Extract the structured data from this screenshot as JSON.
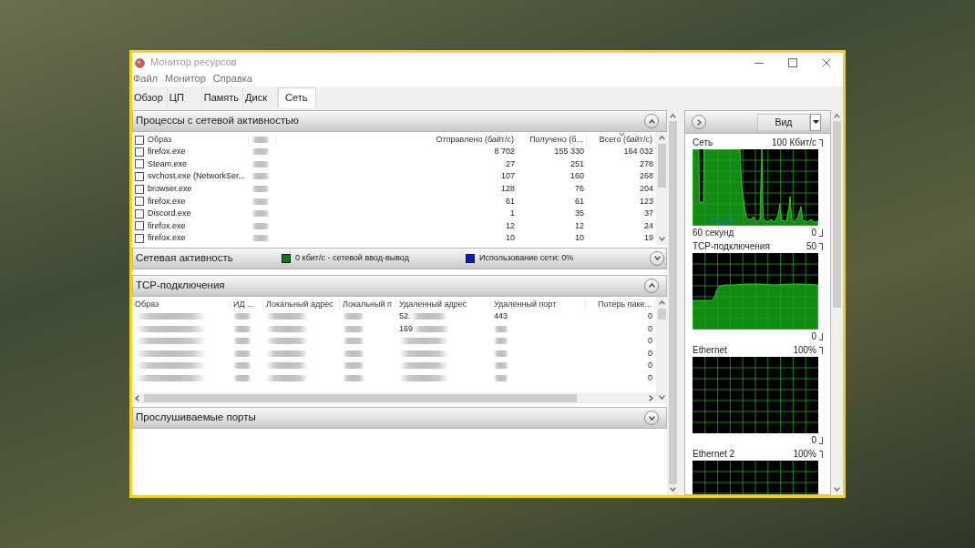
{
  "window": {
    "title": "Монитор ресурсов"
  },
  "menu": [
    "Файл",
    "Монитор",
    "Справка"
  ],
  "tabs": [
    {
      "label": "Обзор",
      "selected": false
    },
    {
      "label": "ЦП",
      "selected": false
    },
    {
      "label": "Память",
      "selected": false
    },
    {
      "label": "Диск",
      "selected": false
    },
    {
      "label": "Сеть",
      "selected": true
    }
  ],
  "sections": [
    {
      "title": "Процессы с сетевой активностью",
      "expanded": true,
      "table": {
        "kind": "processes",
        "header_checked": false,
        "columns": [
          {
            "kind": "text",
            "label": "Образ",
            "sorted": false
          },
          {
            "kind": "blurred",
            "sorted": false
          },
          {
            "kind": "text",
            "label": "Отправлено (байт/с)",
            "sorted": false
          },
          {
            "kind": "text",
            "label": "Получено (б...",
            "sorted": false
          },
          {
            "kind": "text",
            "label": "Всего (байт/с)",
            "sorted": true
          }
        ],
        "rows": [
          {
            "checked": false,
            "cells": [
              {
                "kind": "text",
                "text": "firefox.exe"
              },
              {
                "kind": "blurred"
              },
              {
                "kind": "text",
                "text": "8 702"
              },
              {
                "kind": "text",
                "text": "155 330"
              },
              {
                "kind": "text",
                "text": "164 032"
              }
            ]
          },
          {
            "checked": false,
            "cells": [
              {
                "kind": "text",
                "text": "Steam.exe"
              },
              {
                "kind": "blurred"
              },
              {
                "kind": "text",
                "text": "27"
              },
              {
                "kind": "text",
                "text": "251"
              },
              {
                "kind": "text",
                "text": "278"
              }
            ]
          },
          {
            "checked": false,
            "cells": [
              {
                "kind": "text",
                "text": "svchost.exe (NetworkSer..."
              },
              {
                "kind": "blurred"
              },
              {
                "kind": "text",
                "text": "107"
              },
              {
                "kind": "text",
                "text": "160"
              },
              {
                "kind": "text",
                "text": "268"
              }
            ]
          },
          {
            "checked": false,
            "cells": [
              {
                "kind": "text",
                "text": "browser.exe"
              },
              {
                "kind": "blurred"
              },
              {
                "kind": "text",
                "text": "128"
              },
              {
                "kind": "text",
                "text": "76"
              },
              {
                "kind": "text",
                "text": "204"
              }
            ]
          },
          {
            "checked": false,
            "cells": [
              {
                "kind": "text",
                "text": "firefox.exe"
              },
              {
                "kind": "blurred"
              },
              {
                "kind": "text",
                "text": "61"
              },
              {
                "kind": "text",
                "text": "61"
              },
              {
                "kind": "text",
                "text": "123"
              }
            ]
          },
          {
            "checked": false,
            "cells": [
              {
                "kind": "text",
                "text": "Discord.exe"
              },
              {
                "kind": "blurred"
              },
              {
                "kind": "text",
                "text": "1"
              },
              {
                "kind": "text",
                "text": "35"
              },
              {
                "kind": "text",
                "text": "37"
              }
            ]
          },
          {
            "checked": false,
            "cells": [
              {
                "kind": "text",
                "text": "firefox.exe"
              },
              {
                "kind": "blurred"
              },
              {
                "kind": "text",
                "text": "12"
              },
              {
                "kind": "text",
                "text": "12"
              },
              {
                "kind": "text",
                "text": "24"
              }
            ]
          },
          {
            "checked": false,
            "cells": [
              {
                "kind": "text",
                "text": "firefox.exe"
              },
              {
                "kind": "blurred"
              },
              {
                "kind": "text",
                "text": "10"
              },
              {
                "kind": "text",
                "text": "10"
              },
              {
                "kind": "text",
                "text": "19"
              }
            ]
          }
        ]
      }
    },
    {
      "title": "Сетевая активность",
      "expanded": false,
      "legend": [
        {
          "text": "0 кбит/с - сетевой ввод-вывод",
          "color": "#0b7a18"
        },
        {
          "text": "Использование сети: 0%",
          "color": "#0a1ec8"
        }
      ]
    },
    {
      "title": "TCP-подключения",
      "expanded": true,
      "table": {
        "kind": "tcp",
        "columns": [
          {
            "kind": "text",
            "label": "Образ"
          },
          {
            "kind": "text",
            "label": "ИД ..."
          },
          {
            "kind": "text",
            "label": "Локальный адрес"
          },
          {
            "kind": "text",
            "label": "Локальный п"
          },
          {
            "kind": "text",
            "label": "Удаленный адрес"
          },
          {
            "kind": "text",
            "label": "Удаленный порт"
          },
          {
            "kind": "text",
            "label": "Потерь паке..."
          }
        ],
        "rows": [
          {
            "cells": [
              {
                "kind": "blurred"
              },
              {
                "kind": "blurred"
              },
              {
                "kind": "blurred"
              },
              {
                "kind": "blurred"
              },
              {
                "kind": "partial",
                "text": "52."
              },
              {
                "kind": "text",
                "text": "443"
              },
              {
                "kind": "text",
                "text": "0"
              }
            ]
          },
          {
            "cells": [
              {
                "kind": "blurred"
              },
              {
                "kind": "blurred"
              },
              {
                "kind": "blurred"
              },
              {
                "kind": "blurred"
              },
              {
                "kind": "partial",
                "text": "169"
              },
              {
                "kind": "blurred"
              },
              {
                "kind": "text",
                "text": "0"
              }
            ]
          },
          {
            "cells": [
              {
                "kind": "blurred"
              },
              {
                "kind": "blurred"
              },
              {
                "kind": "blurred"
              },
              {
                "kind": "blurred"
              },
              {
                "kind": "blurred"
              },
              {
                "kind": "blurred"
              },
              {
                "kind": "text",
                "text": "0"
              }
            ]
          },
          {
            "cells": [
              {
                "kind": "blurred"
              },
              {
                "kind": "blurred"
              },
              {
                "kind": "blurred"
              },
              {
                "kind": "blurred"
              },
              {
                "kind": "blurred"
              },
              {
                "kind": "blurred"
              },
              {
                "kind": "text",
                "text": "0"
              }
            ]
          },
          {
            "cells": [
              {
                "kind": "blurred"
              },
              {
                "kind": "blurred"
              },
              {
                "kind": "blurred"
              },
              {
                "kind": "blurred"
              },
              {
                "kind": "blurred"
              },
              {
                "kind": "blurred"
              },
              {
                "kind": "text",
                "text": "0"
              }
            ]
          },
          {
            "cells": [
              {
                "kind": "blurred"
              },
              {
                "kind": "blurred"
              },
              {
                "kind": "blurred"
              },
              {
                "kind": "blurred"
              },
              {
                "kind": "blurred"
              },
              {
                "kind": "blurred"
              },
              {
                "kind": "text",
                "text": "0"
              }
            ]
          }
        ]
      }
    },
    {
      "title": "Прослушиваемые порты",
      "expanded": false
    }
  ],
  "side_panel": {
    "view_button": "Вид",
    "graphs": [
      {
        "kind": "traffic",
        "title": "Сеть",
        "scale": "100 Кбит/с",
        "time": "60 секунд",
        "zero": "0"
      },
      {
        "kind": "connections",
        "title": "TCP-подключения",
        "scale": "50",
        "zero": "0"
      },
      {
        "kind": "idle",
        "title": "Ethernet",
        "scale": "100%",
        "zero": "0"
      },
      {
        "kind": "idle",
        "title": "Ethernet 2",
        "scale": "100%"
      }
    ]
  }
}
